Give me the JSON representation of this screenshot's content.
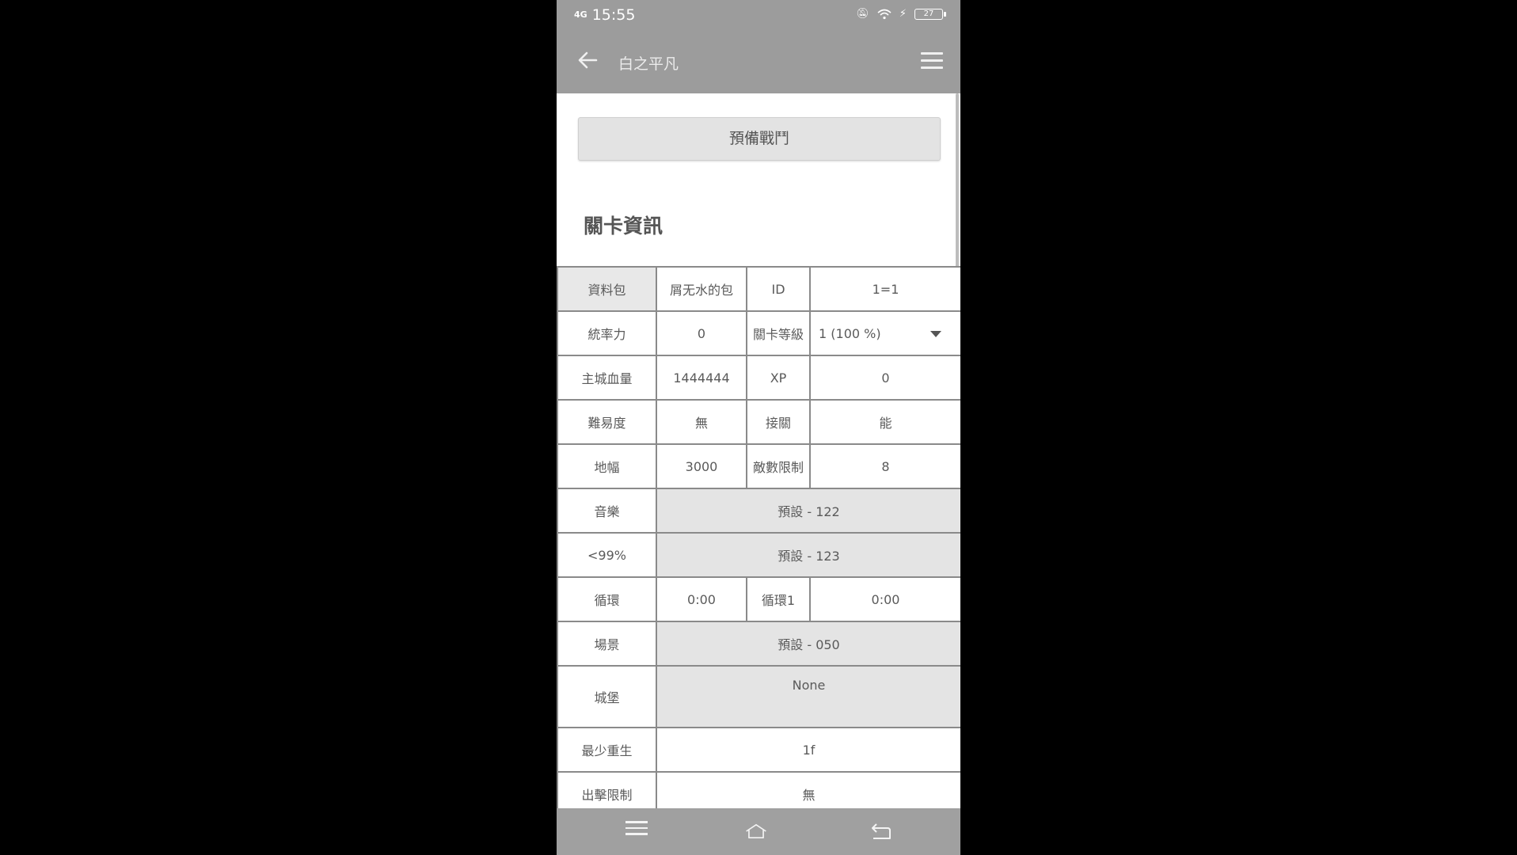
{
  "status_bar": {
    "network": "4G",
    "time": "15:55",
    "battery": "27"
  },
  "app_bar": {
    "title": "白之平凡"
  },
  "prepare_button": "預備戰鬥",
  "section_title": "關卡資訊",
  "table": {
    "pack_label": "資料包",
    "pack_value": "屑无水的包",
    "id_label": "ID",
    "id_value": "1=1",
    "leadership_label": "統率力",
    "leadership_value": "0",
    "stage_level_label": "關卡等級",
    "stage_level_value": "1 (100 %)",
    "base_hp_label": "主城血量",
    "base_hp_value": "1444444",
    "xp_label": "XP",
    "xp_value": "0",
    "difficulty_label": "難易度",
    "difficulty_value": "無",
    "continue_label": "接關",
    "continue_value": "能",
    "map_width_label": "地幅",
    "map_width_value": "3000",
    "enemy_limit_label": "敵數限制",
    "enemy_limit_value": "8",
    "music_label": "音樂",
    "music_value": "預設 - 122",
    "music99_label": "<99%",
    "music99_value": "預設 - 123",
    "loop_label": "循環",
    "loop_value": "0:00",
    "loop1_label": "循環1",
    "loop1_value": "0:00",
    "scene_label": "場景",
    "scene_value": "預設 - 050",
    "castle_label": "城堡",
    "castle_value": "None",
    "min_respawn_label": "最少重生",
    "min_respawn_value": "1f",
    "deploy_limit_label": "出擊限制",
    "deploy_limit_value": "無"
  },
  "colors": {
    "app_bar": "#9c9c9c",
    "shaded_cell": "#e4e4e4",
    "border": "#8a8a8a"
  }
}
